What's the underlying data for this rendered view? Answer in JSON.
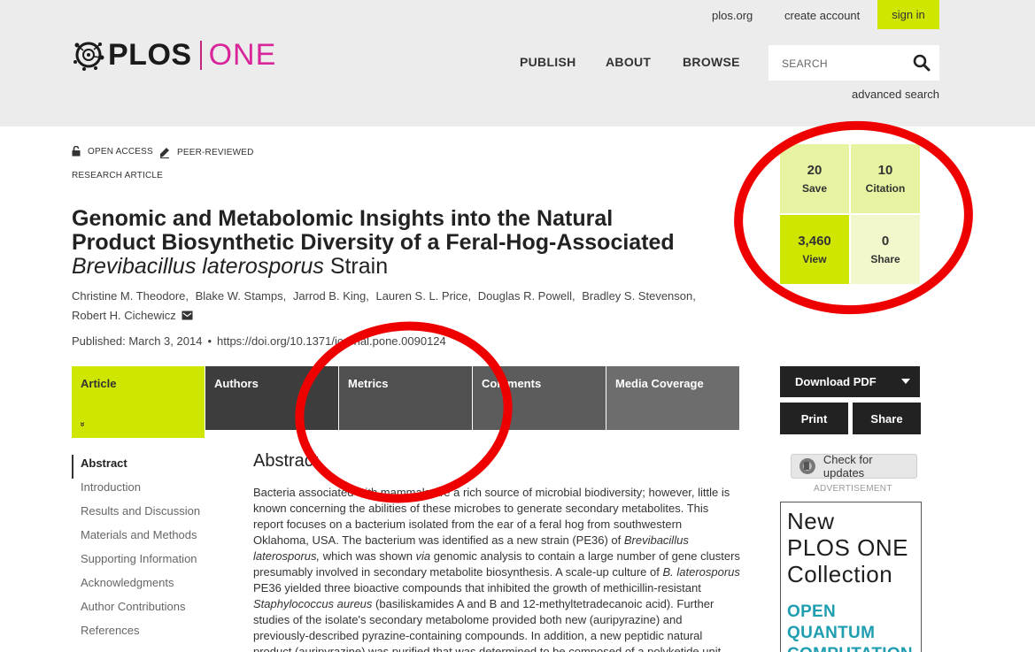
{
  "header": {
    "plos_link": "plos.org",
    "create_account": "create account",
    "sign_in": "sign in",
    "logo_plos": "PLOS",
    "logo_one": "ONE",
    "nav": [
      "PUBLISH",
      "ABOUT",
      "BROWSE"
    ],
    "search_placeholder": "SEARCH",
    "advanced_search": "advanced search"
  },
  "article": {
    "badges": [
      "OPEN ACCESS",
      "PEER-REVIEWED"
    ],
    "type": "RESEARCH ARTICLE",
    "title_line1": "Genomic and Metabolomic Insights into the Natural",
    "title_line2": "Product Biosynthetic Diversity of a Feral-Hog-Associated",
    "title_italic": "Brevibacillus laterosporus",
    "title_end": "Strain",
    "authors": [
      "Christine M. Theodore,",
      "Blake W. Stamps,",
      "Jarrod B. King,",
      "Lauren S. L. Price,",
      "Douglas R. Powell,",
      "Bradley S. Stevenson,",
      "Robert H. Cichewicz"
    ],
    "published": "Published: March 3, 2014",
    "dot": "•",
    "doi": "https://doi.org/10.1371/journal.pone.0090124"
  },
  "metrics": [
    {
      "value": "20",
      "label": "Save",
      "color": "#e7f3a0"
    },
    {
      "value": "10",
      "label": "Citation",
      "color": "#e7f3a0"
    },
    {
      "value": "3,460",
      "label": "View",
      "color": "#cfe600"
    },
    {
      "value": "0",
      "label": "Share",
      "color": "#f2f8cc"
    }
  ],
  "tabs": [
    {
      "label": "Article",
      "color": "#cfe600"
    },
    {
      "label": "Authors",
      "color": "#3d3d3d"
    },
    {
      "label": "Metrics",
      "color": "#505050"
    },
    {
      "label": "Comments",
      "color": "#5c5c5c"
    },
    {
      "label": "Media Coverage",
      "color": "#6d6d6d"
    }
  ],
  "tab_chevron": "»",
  "sidenav": [
    "Abstract",
    "Introduction",
    "Results and Discussion",
    "Materials and Methods",
    "Supporting Information",
    "Acknowledgments",
    "Author Contributions",
    "References"
  ],
  "abstract": {
    "heading": "Abstract",
    "s1": "Bacteria associated with mammals are a rich source of microbial biodiversity; however, little is known concerning the abilities of these microbes to generate secondary metabolites. This report focuses on a bacterium isolated from the ear of a feral hog from southwestern Oklahoma, USA. The bacterium was identified as a new strain (PE36) of ",
    "i1": "Brevibacillus laterosporus,",
    "s2": " which was shown ",
    "i2": "via",
    "s3": " genomic analysis to contain a large number of gene clusters presumably involved in secondary metabolite biosynthesis. A scale-up culture of ",
    "i3": "B. laterosporus",
    "s4": " PE36 yielded three bioactive compounds that inhibited the growth of methicillin-resistant ",
    "i4": "Staphylococcus aureus",
    "s5": " (basiliskamides A and B and 12-methyltetradecanoic acid). Further studies of the isolate's secondary metabolome provided both new (auripyrazine) and previously-described pyrazine-containing compounds. In addition, a new peptidic natural product (auripyrazine) was purified that was determined to be composed of a polyketide unit, two"
  },
  "sidebar": {
    "download_pdf": "Download PDF",
    "print": "Print",
    "share": "Share",
    "check_updates": "Check for updates",
    "advertisement": "ADVERTISEMENT",
    "ad_lines": [
      "New",
      "PLOS ONE",
      "Collection"
    ],
    "ad_lines2": [
      "OPEN",
      "QUANTUM",
      "COMPUTATION"
    ]
  },
  "colors": {
    "accent_green": "#cfe600",
    "brand_magenta": "#d9259a",
    "annotation_red": "#ee0000"
  }
}
